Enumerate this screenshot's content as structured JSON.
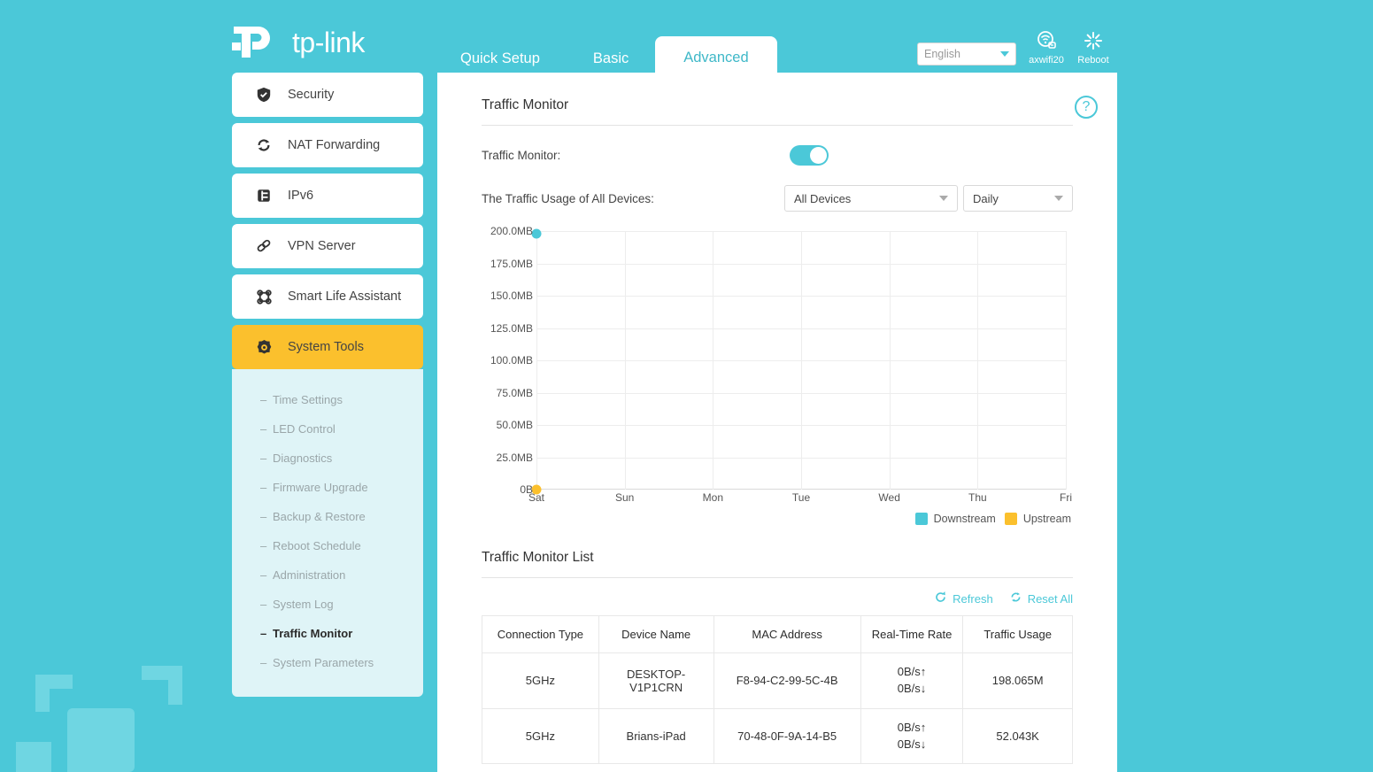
{
  "brand": {
    "name": "tp-link"
  },
  "header": {
    "tabs": [
      {
        "label": "Quick Setup",
        "active": false
      },
      {
        "label": "Basic",
        "active": false
      },
      {
        "label": "Advanced",
        "active": true
      }
    ],
    "language": "English",
    "icons": [
      {
        "name": "wifi-cloud-icon",
        "label": "axwifi20"
      },
      {
        "name": "reboot-icon",
        "label": "Reboot"
      }
    ]
  },
  "sidebar": {
    "items": [
      {
        "label": "Security",
        "icon": "shield-check-icon",
        "active": false
      },
      {
        "label": "NAT Forwarding",
        "icon": "refresh-arrows-icon",
        "active": false
      },
      {
        "label": "IPv6",
        "icon": "document-icon",
        "active": false
      },
      {
        "label": "VPN Server",
        "icon": "chain-link-icon",
        "active": false
      },
      {
        "label": "Smart Life Assistant",
        "icon": "grid-squares-icon",
        "active": false
      },
      {
        "label": "System Tools",
        "icon": "gear-icon",
        "active": true
      }
    ],
    "submenu": [
      {
        "label": "Time Settings",
        "active": false
      },
      {
        "label": "LED Control",
        "active": false
      },
      {
        "label": "Diagnostics",
        "active": false
      },
      {
        "label": "Firmware Upgrade",
        "active": false
      },
      {
        "label": "Backup & Restore",
        "active": false
      },
      {
        "label": "Reboot Schedule",
        "active": false
      },
      {
        "label": "Administration",
        "active": false
      },
      {
        "label": "System Log",
        "active": false
      },
      {
        "label": "Traffic Monitor",
        "active": true
      },
      {
        "label": "System Parameters",
        "active": false
      }
    ]
  },
  "main": {
    "section_title": "Traffic Monitor",
    "toggle_label": "Traffic Monitor:",
    "toggle_on": true,
    "usage_label": "The Traffic Usage of All Devices:",
    "device_filter": "All Devices",
    "period_filter": "Daily",
    "list_title": "Traffic Monitor List",
    "refresh_label": "Refresh",
    "reset_label": "Reset All"
  },
  "chart_data": {
    "type": "scatter",
    "title": "",
    "xlabel": "",
    "ylabel": "",
    "categories": [
      "Sat",
      "Sun",
      "Mon",
      "Tue",
      "Wed",
      "Thu",
      "Fri"
    ],
    "ytick_labels": [
      "200.0MB",
      "175.0MB",
      "150.0MB",
      "125.0MB",
      "100.0MB",
      "75.0MB",
      "50.0MB",
      "25.0MB",
      "0B"
    ],
    "ytick_values": [
      200,
      175,
      150,
      125,
      100,
      75,
      50,
      25,
      0
    ],
    "ylim": [
      0,
      200
    ],
    "grid": true,
    "legend_position": "bottom-right",
    "series": [
      {
        "name": "Downstream",
        "color": "#4bc8d8",
        "values": [
          198.065,
          null,
          null,
          null,
          null,
          null,
          null
        ]
      },
      {
        "name": "Upstream",
        "color": "#fbc02d",
        "values": [
          0.052,
          null,
          null,
          null,
          null,
          null,
          null
        ]
      }
    ]
  },
  "table": {
    "columns": [
      "Connection Type",
      "Device Name",
      "MAC Address",
      "Real-Time Rate",
      "Traffic Usage"
    ],
    "rows": [
      {
        "connection_type": "5GHz",
        "device_name": "DESKTOP-V1P1CRN",
        "mac_address": "F8-94-C2-99-5C-4B",
        "rate_up": "0B/s↑",
        "rate_down": "0B/s↓",
        "traffic_usage": "198.065M"
      },
      {
        "connection_type": "5GHz",
        "device_name": "Brians-iPad",
        "mac_address": "70-48-0F-9A-14-B5",
        "rate_up": "0B/s↑",
        "rate_down": "0B/s↓",
        "traffic_usage": "52.043K"
      }
    ]
  },
  "colors": {
    "brand_teal": "#4bc8d8",
    "accent_yellow": "#fbc02d",
    "submenu_bg": "#dff4f7"
  }
}
